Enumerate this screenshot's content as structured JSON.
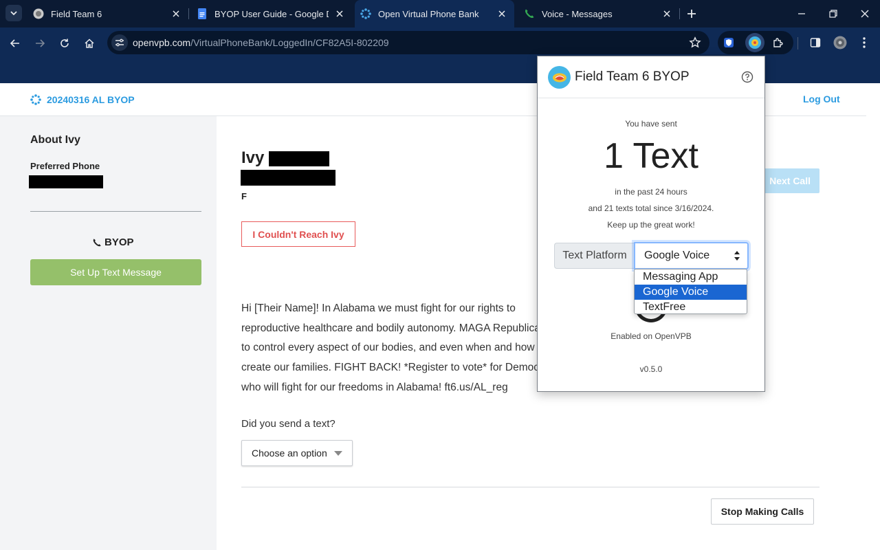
{
  "browser": {
    "tabs": [
      {
        "title": "Field Team 6",
        "icon": "field-team-6-icon"
      },
      {
        "title": "BYOP User Guide - Google Docs",
        "icon": "google-docs-icon"
      },
      {
        "title": "Open Virtual Phone Bank",
        "icon": "openvpb-icon"
      },
      {
        "title": "Voice - Messages",
        "icon": "google-voice-icon"
      }
    ],
    "active_tab": 2,
    "url_host": "openvpb.com",
    "url_path": "/VirtualPhoneBank/LoggedIn/CF82A5I-802209"
  },
  "header": {
    "campaign": "20240316 AL BYOP",
    "logout": "Log Out"
  },
  "sidebar": {
    "title": "About Ivy",
    "preferred_phone_label": "Preferred Phone",
    "byop_label": "BYOP",
    "setup_button": "Set Up Text Message"
  },
  "contact": {
    "first_name": "Ivy",
    "gender": "F",
    "couldnt_reach_button": "I Couldn't Reach Ivy",
    "next_call_button": "Next Call"
  },
  "script": {
    "lines": [
      "Hi [Their Name]! In Alabama we must fight for our rights to",
      "reproductive healthcare and bodily autonomy. MAGA Republicans want",
      "to control every aspect of our bodies, and even when and how we",
      "create our families. FIGHT BACK! *Register to vote* for Democrats",
      "who will fight for our freedoms in Alabama! ft6.us/AL_reg"
    ]
  },
  "survey": {
    "question": "Did you send a text?",
    "select_value": "Choose an option"
  },
  "footer": {
    "stop_button": "Stop Making Calls"
  },
  "popup": {
    "title": "Field Team 6 BYOP",
    "sent_label": "You have sent",
    "sent_count": "1 Text",
    "line1": "in the past 24 hours",
    "line2": "and 21 texts total since 3/16/2024.",
    "line3": "Keep up the great work!",
    "platform_label": "Text Platform",
    "platform_value": "Google Voice",
    "platform_options": [
      "Messaging App",
      "Google Voice",
      "TextFree"
    ],
    "selected_option_index": 1,
    "status": "Enabled on OpenVPB",
    "version": "v0.5.0"
  },
  "colors": {
    "brand_blue": "#2b9be0",
    "chrome_navy": "#0f2a55",
    "setup_green": "#95c06a",
    "alert_red": "#e05050",
    "select_highlight": "#1a66d2"
  }
}
